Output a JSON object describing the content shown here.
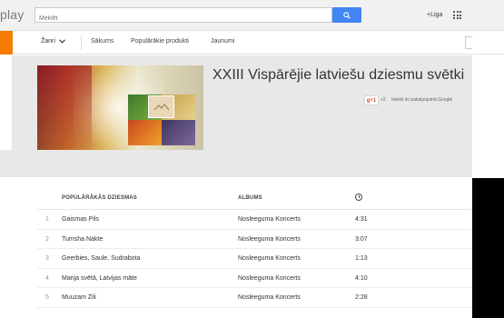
{
  "topbar": {
    "logo_text": "play",
    "search_placeholder": "Meklēt",
    "user_label": "+Liga"
  },
  "nav": {
    "genre_label": "Žanri",
    "items": [
      "Sākums",
      "Populārākie produkti",
      "Jaunumi"
    ]
  },
  "album": {
    "title": "XXIII Vispārējie latviešu dziesmu svētki",
    "gplus_label": "g+1",
    "gplus_count": "+2",
    "recommend_text": "Ieteikt šo pakalpojumā Google"
  },
  "table": {
    "headers": {
      "song": "POPULĀRĀKĀS DZIESMAS",
      "album": "ALBUMS"
    },
    "rows": [
      {
        "num": "1",
        "song": "Gaismas Pils",
        "album": "Nosleeguma Koncerts",
        "duration": "4:31"
      },
      {
        "num": "2",
        "song": "Tumsha Nakte",
        "album": "Nosleeguma Koncerts",
        "duration": "3:07"
      },
      {
        "num": "3",
        "song": "Geerbies, Saule, Sudrabota",
        "album": "Nosleeguma Koncerts",
        "duration": "1:13"
      },
      {
        "num": "4",
        "song": "Marija svētā, Latvijas māte",
        "album": "Nosleeguma Koncerts",
        "duration": "4:10"
      },
      {
        "num": "5",
        "song": "Muuzam Zili",
        "album": "Nosleeguma Koncerts",
        "duration": "2:28"
      }
    ]
  }
}
